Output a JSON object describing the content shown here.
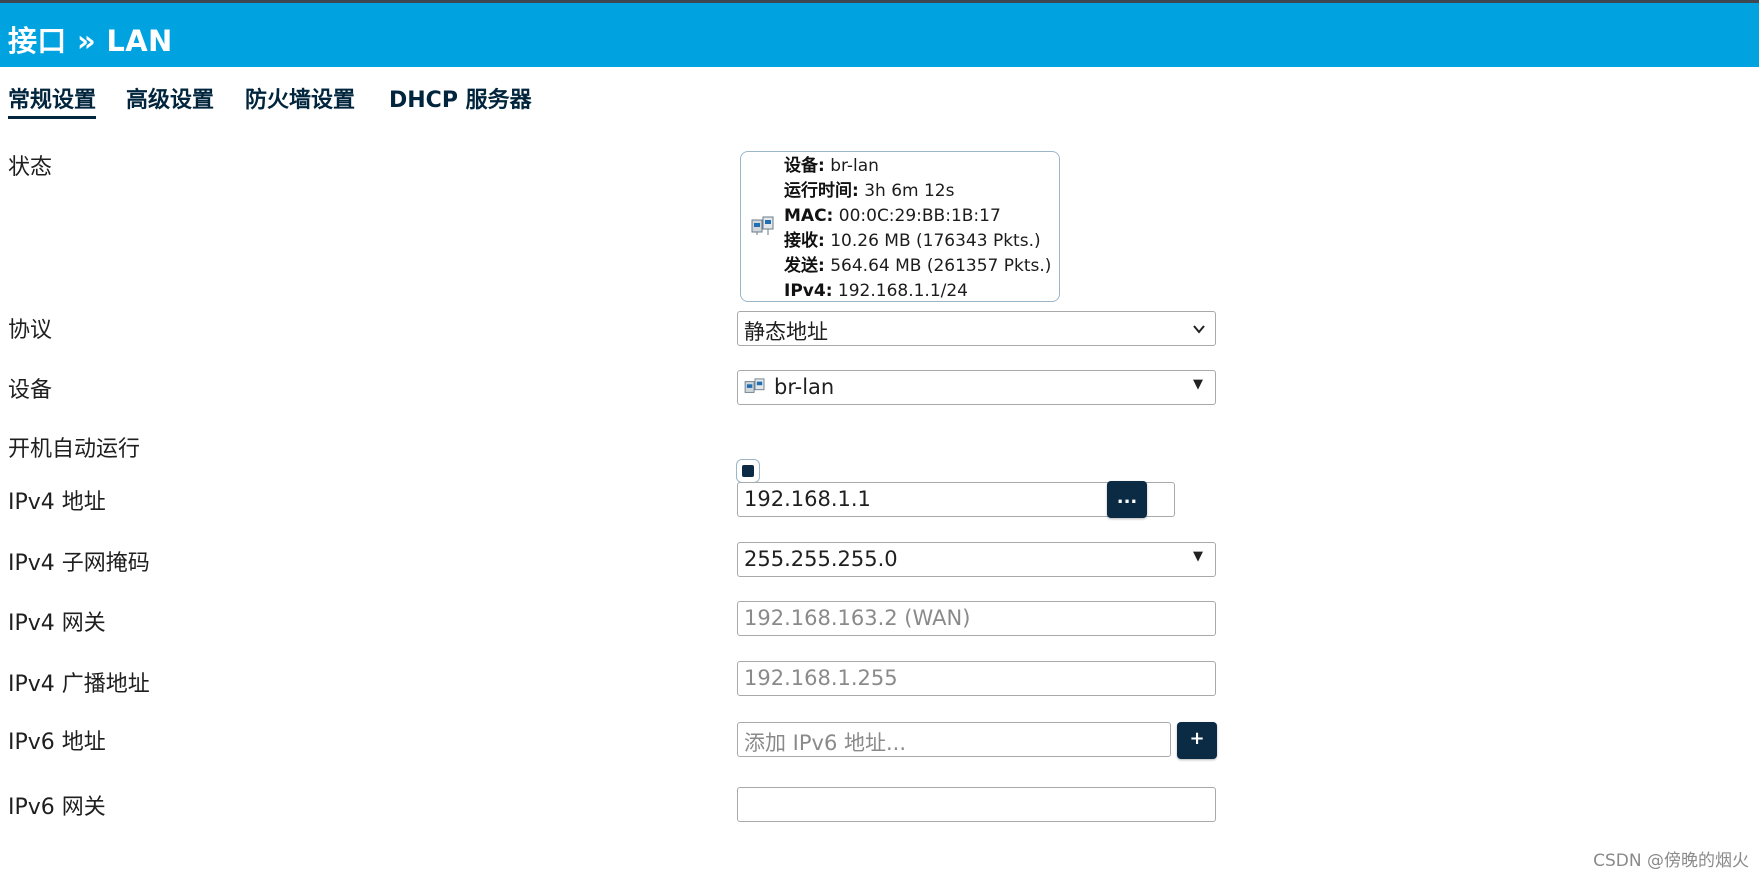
{
  "header": {
    "title": "接口 » LAN"
  },
  "tabs": [
    {
      "label": "常规设置",
      "active": true
    },
    {
      "label": "高级设置"
    },
    {
      "label": "防火墙设置"
    },
    {
      "label": "DHCP 服务器"
    }
  ],
  "status": {
    "label": "状态",
    "icon": "network-interface-icon",
    "lines": [
      {
        "key": "设备:",
        "value": " br-lan"
      },
      {
        "key": "运行时间:",
        "value": " 3h 6m 12s"
      },
      {
        "key": "MAC:",
        "value": " 00:0C:29:BB:1B:17"
      },
      {
        "key": "接收:",
        "value": " 10.26 MB (176343 Pkts.)"
      },
      {
        "key": "发送:",
        "value": " 564.64 MB (261357 Pkts.)"
      },
      {
        "key": "IPv4:",
        "value": " 192.168.1.1/24"
      }
    ]
  },
  "protocol": {
    "label": "协议",
    "value": "静态地址"
  },
  "device": {
    "label": "设备",
    "value": "br-lan",
    "icon": "network-interface-icon"
  },
  "autostart": {
    "label": "开机自动运行",
    "checked": true
  },
  "ipv4_address": {
    "label": "IPv4 地址",
    "value": "192.168.1.1",
    "button": "..."
  },
  "ipv4_netmask": {
    "label": "IPv4 子网掩码",
    "value": "255.255.255.0"
  },
  "ipv4_gateway": {
    "label": "IPv4 网关",
    "placeholder": "192.168.163.2 (WAN)"
  },
  "ipv4_broadcast": {
    "label": "IPv4 广播地址",
    "placeholder": "192.168.1.255"
  },
  "ipv6_address": {
    "label": "IPv6 地址",
    "placeholder": "添加 IPv6 地址...",
    "button": "+"
  },
  "ipv6_gateway": {
    "label": "IPv6 网关",
    "value": ""
  },
  "watermark": "CSDN @傍晚的烟火",
  "colors": {
    "header_bg": "#00a3e0",
    "accent_dark": "#0b2a44",
    "tab_text": "#00253c"
  }
}
